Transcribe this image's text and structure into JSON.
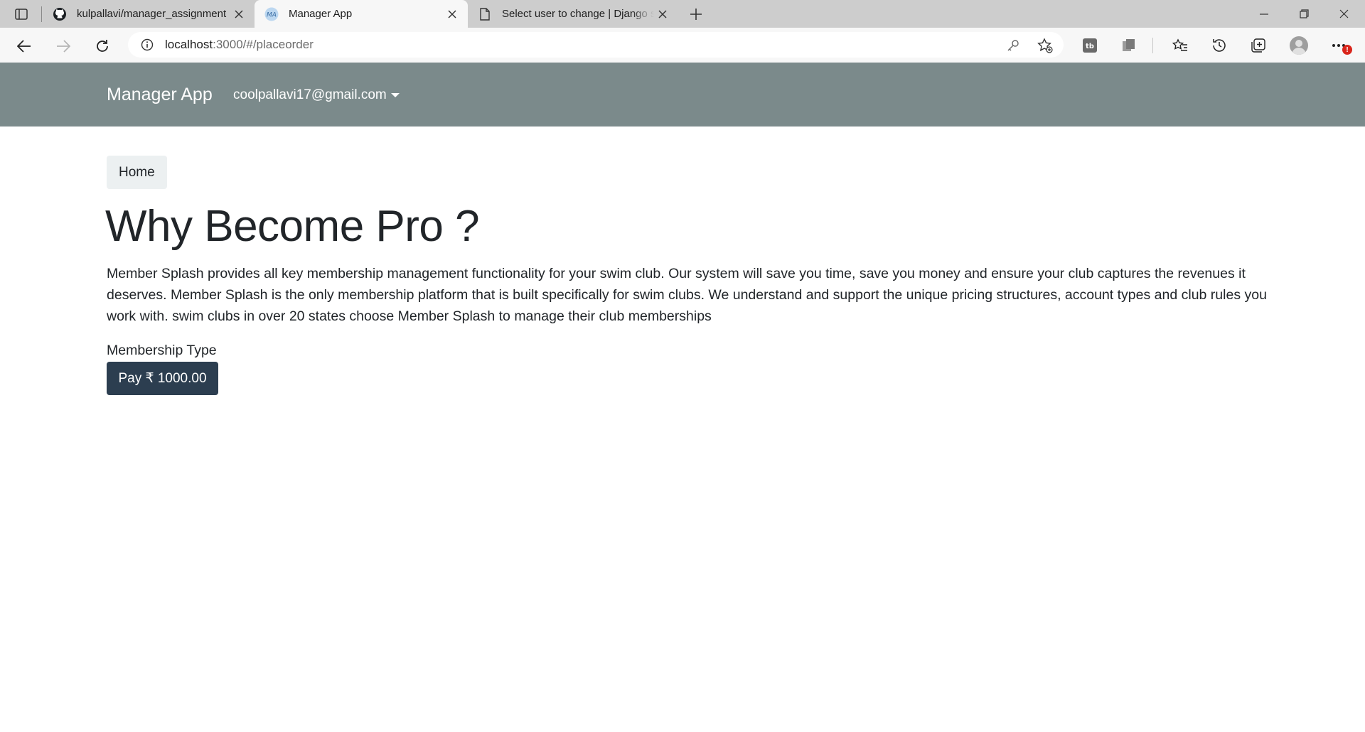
{
  "browser": {
    "tabs": [
      {
        "title": "kulpallavi/manager_assignment",
        "favicon": "github-icon",
        "active": false
      },
      {
        "title": "Manager App",
        "favicon": "ma-icon",
        "active": true
      },
      {
        "title": "Select user to change | Django si",
        "favicon": "page-icon",
        "active": false
      }
    ],
    "favicon_ma_text": "MA",
    "url_host": "localhost",
    "url_rest": ":3000/#/placeorder",
    "notification_badge": "!"
  },
  "app": {
    "brand": "Manager App",
    "user_email": "coolpallavi17@gmail.com",
    "breadcrumb_home": "Home",
    "title": "Why Become Pro ?",
    "description": "Member Splash provides all key membership management functionality for your swim club. Our system will save you time, save you money and ensure your club captures the revenues it deserves. Member Splash is the only membership platform that is built specifically for swim clubs. We understand and support the unique pricing structures, account types and club rules you work with. swim clubs in over 20 states choose Member Splash to manage their club memberships",
    "membership_label": "Membership Type",
    "pay_button": "Pay ₹ 1000.00"
  },
  "colors": {
    "navbar": "#7b8a8b",
    "primary_button": "#2c3e50",
    "breadcrumb_bg": "#ecf0f1"
  }
}
